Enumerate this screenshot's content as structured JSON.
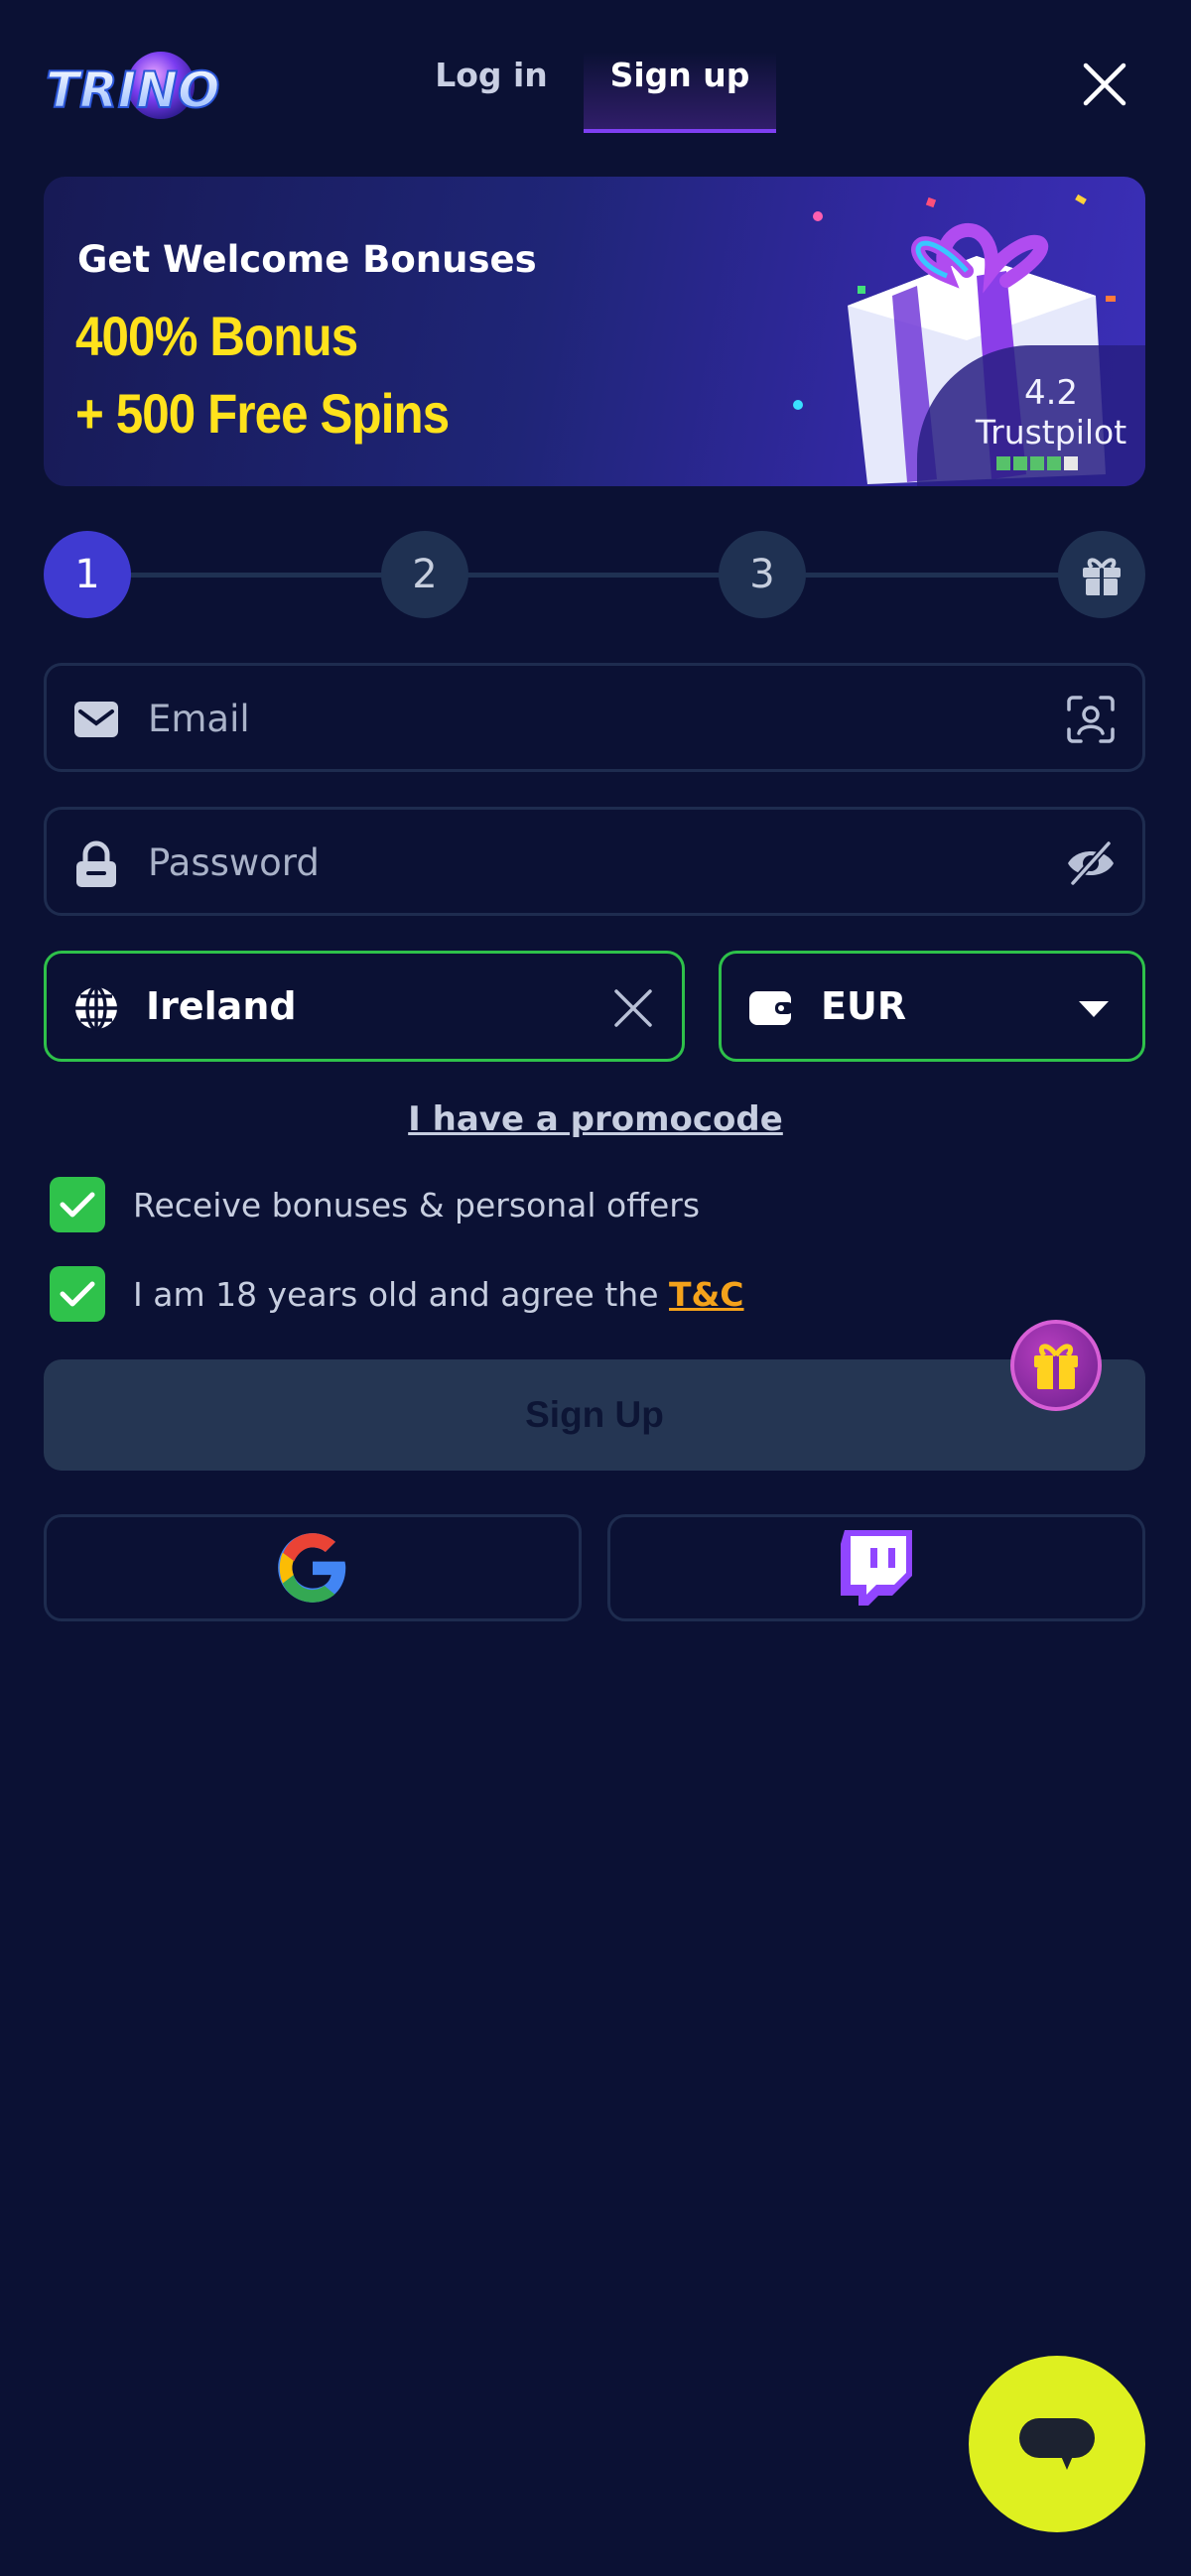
{
  "header": {
    "logo_text": "TRINO",
    "tabs": [
      {
        "label": "Log in",
        "active": false
      },
      {
        "label": "Sign up",
        "active": true
      }
    ],
    "close_icon": "close-icon"
  },
  "banner": {
    "title": "Get Welcome Bonuses",
    "line1": "400% Bonus",
    "line2": "+ 500 Free Spins",
    "rating": "4.2",
    "rating_label": "Trustpilot"
  },
  "stepper": {
    "steps": [
      "1",
      "2",
      "3"
    ],
    "active_step": 1,
    "final_icon": "gift-icon"
  },
  "form": {
    "email": {
      "placeholder": "Email",
      "value": ""
    },
    "password": {
      "placeholder": "Password",
      "value": ""
    },
    "country": {
      "value": "Ireland"
    },
    "currency": {
      "value": "EUR"
    },
    "promo_link": "I have a promocode",
    "checkbox_offers": {
      "label": "Receive bonuses & personal offers",
      "checked": true
    },
    "checkbox_terms": {
      "label": "I am 18 years old and agree the",
      "link": "T&C",
      "checked": true
    },
    "submit_label": "Sign Up"
  },
  "social": [
    {
      "name": "google",
      "icon": "google-icon"
    },
    {
      "name": "twitch",
      "icon": "twitch-icon"
    }
  ],
  "colors": {
    "background": "#0b1134",
    "accent_purple": "#3f3ad1",
    "success_green": "#2fc24b",
    "bonus_yellow": "#ffe21c",
    "chat_fab": "#def020",
    "link_orange": "#f4a21b"
  }
}
